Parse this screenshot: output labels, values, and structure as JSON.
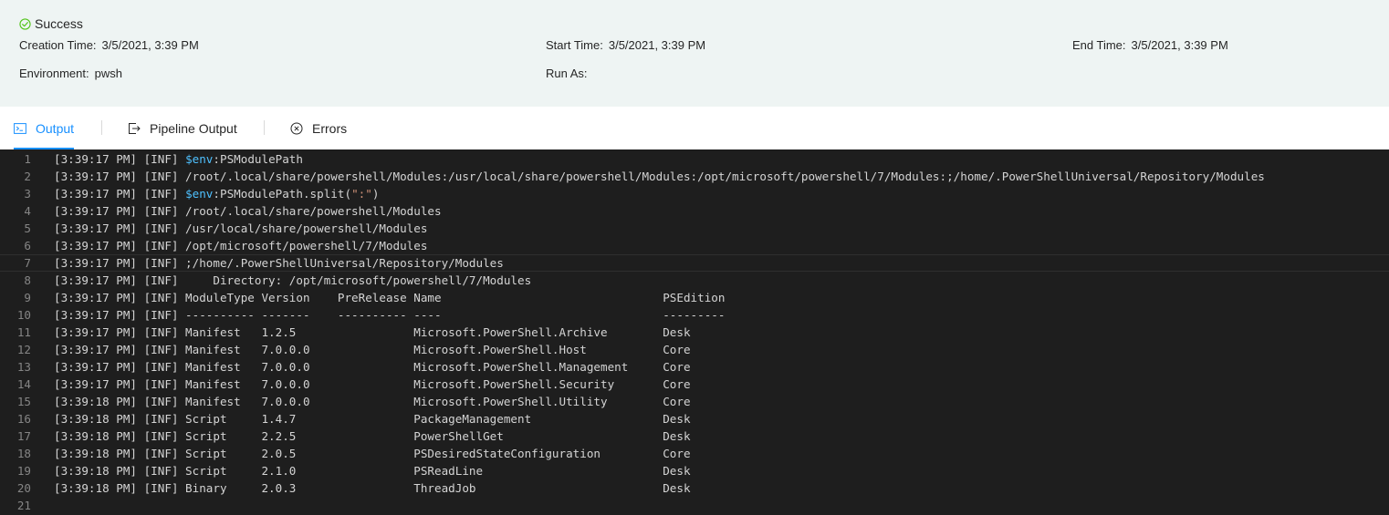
{
  "summary": {
    "status": "Success",
    "creation_time_label": "Creation Time:",
    "creation_time_value": "3/5/2021, 3:39 PM",
    "start_time_label": "Start Time:",
    "start_time_value": "3/5/2021, 3:39 PM",
    "end_time_label": "End Time:",
    "end_time_value": "3/5/2021, 3:39 PM",
    "environment_label": "Environment:",
    "environment_value": "pwsh",
    "run_as_label": "Run As:",
    "run_as_value": ""
  },
  "tabs": {
    "output": "Output",
    "pipeline_output": "Pipeline Output",
    "errors": "Errors",
    "active": "output"
  },
  "colors": {
    "accent": "#1890ff",
    "success": "#52c41a",
    "console_bg": "#1e1e1e",
    "variable": "#4fc1ff",
    "string": "#ce9178"
  },
  "console": {
    "lines": [
      {
        "n": "1",
        "parts": [
          {
            "t": "[3:39:17 PM] [INF] "
          },
          {
            "t": "$env",
            "c": "var"
          },
          {
            "t": ":PSModulePath"
          }
        ]
      },
      {
        "n": "2",
        "parts": [
          {
            "t": "[3:39:17 PM] [INF] /root/.local/share/powershell/Modules:/usr/local/share/powershell/Modules:/opt/microsoft/powershell/7/Modules:;/home/.PowerShellUniversal/Repository/Modules"
          }
        ]
      },
      {
        "n": "3",
        "parts": [
          {
            "t": "[3:39:17 PM] [INF] "
          },
          {
            "t": "$env",
            "c": "var"
          },
          {
            "t": ":PSModulePath.split("
          },
          {
            "t": "\":\"",
            "c": "str"
          },
          {
            "t": ")"
          }
        ]
      },
      {
        "n": "4",
        "parts": [
          {
            "t": "[3:39:17 PM] [INF] /root/.local/share/powershell/Modules"
          }
        ]
      },
      {
        "n": "5",
        "parts": [
          {
            "t": "[3:39:17 PM] [INF] /usr/local/share/powershell/Modules"
          }
        ]
      },
      {
        "n": "6",
        "parts": [
          {
            "t": "[3:39:17 PM] [INF] /opt/microsoft/powershell/7/Modules"
          }
        ]
      },
      {
        "n": "7",
        "parts": [
          {
            "t": "[3:39:17 PM] [INF] ;/home/.PowerShellUniversal/Repository/Modules"
          }
        ],
        "current": true
      },
      {
        "n": "8",
        "parts": [
          {
            "t": "[3:39:17 PM] [INF]     Directory: /opt/microsoft/powershell/7/Modules"
          }
        ]
      },
      {
        "n": "9",
        "parts": [
          {
            "t": "[3:39:17 PM] [INF] ModuleType Version    PreRelease Name                                PSEdition"
          }
        ]
      },
      {
        "n": "10",
        "parts": [
          {
            "t": "[3:39:17 PM] [INF] ---------- -------    ---------- ----                                ---------"
          }
        ]
      },
      {
        "n": "11",
        "parts": [
          {
            "t": "[3:39:17 PM] [INF] Manifest   1.2.5                 Microsoft.PowerShell.Archive        Desk"
          }
        ]
      },
      {
        "n": "12",
        "parts": [
          {
            "t": "[3:39:17 PM] [INF] Manifest   7.0.0.0               Microsoft.PowerShell.Host           Core"
          }
        ]
      },
      {
        "n": "13",
        "parts": [
          {
            "t": "[3:39:17 PM] [INF] Manifest   7.0.0.0               Microsoft.PowerShell.Management     Core"
          }
        ]
      },
      {
        "n": "14",
        "parts": [
          {
            "t": "[3:39:17 PM] [INF] Manifest   7.0.0.0               Microsoft.PowerShell.Security       Core"
          }
        ]
      },
      {
        "n": "15",
        "parts": [
          {
            "t": "[3:39:18 PM] [INF] Manifest   7.0.0.0               Microsoft.PowerShell.Utility        Core"
          }
        ]
      },
      {
        "n": "16",
        "parts": [
          {
            "t": "[3:39:18 PM] [INF] Script     1.4.7                 PackageManagement                   Desk"
          }
        ]
      },
      {
        "n": "17",
        "parts": [
          {
            "t": "[3:39:18 PM] [INF] Script     2.2.5                 PowerShellGet                       Desk"
          }
        ]
      },
      {
        "n": "18",
        "parts": [
          {
            "t": "[3:39:18 PM] [INF] Script     2.0.5                 PSDesiredStateConfiguration         Core"
          }
        ]
      },
      {
        "n": "19",
        "parts": [
          {
            "t": "[3:39:18 PM] [INF] Script     2.1.0                 PSReadLine                          Desk"
          }
        ]
      },
      {
        "n": "20",
        "parts": [
          {
            "t": "[3:39:18 PM] [INF] Binary     2.0.3                 ThreadJob                           Desk"
          }
        ]
      },
      {
        "n": "21",
        "parts": []
      }
    ]
  }
}
